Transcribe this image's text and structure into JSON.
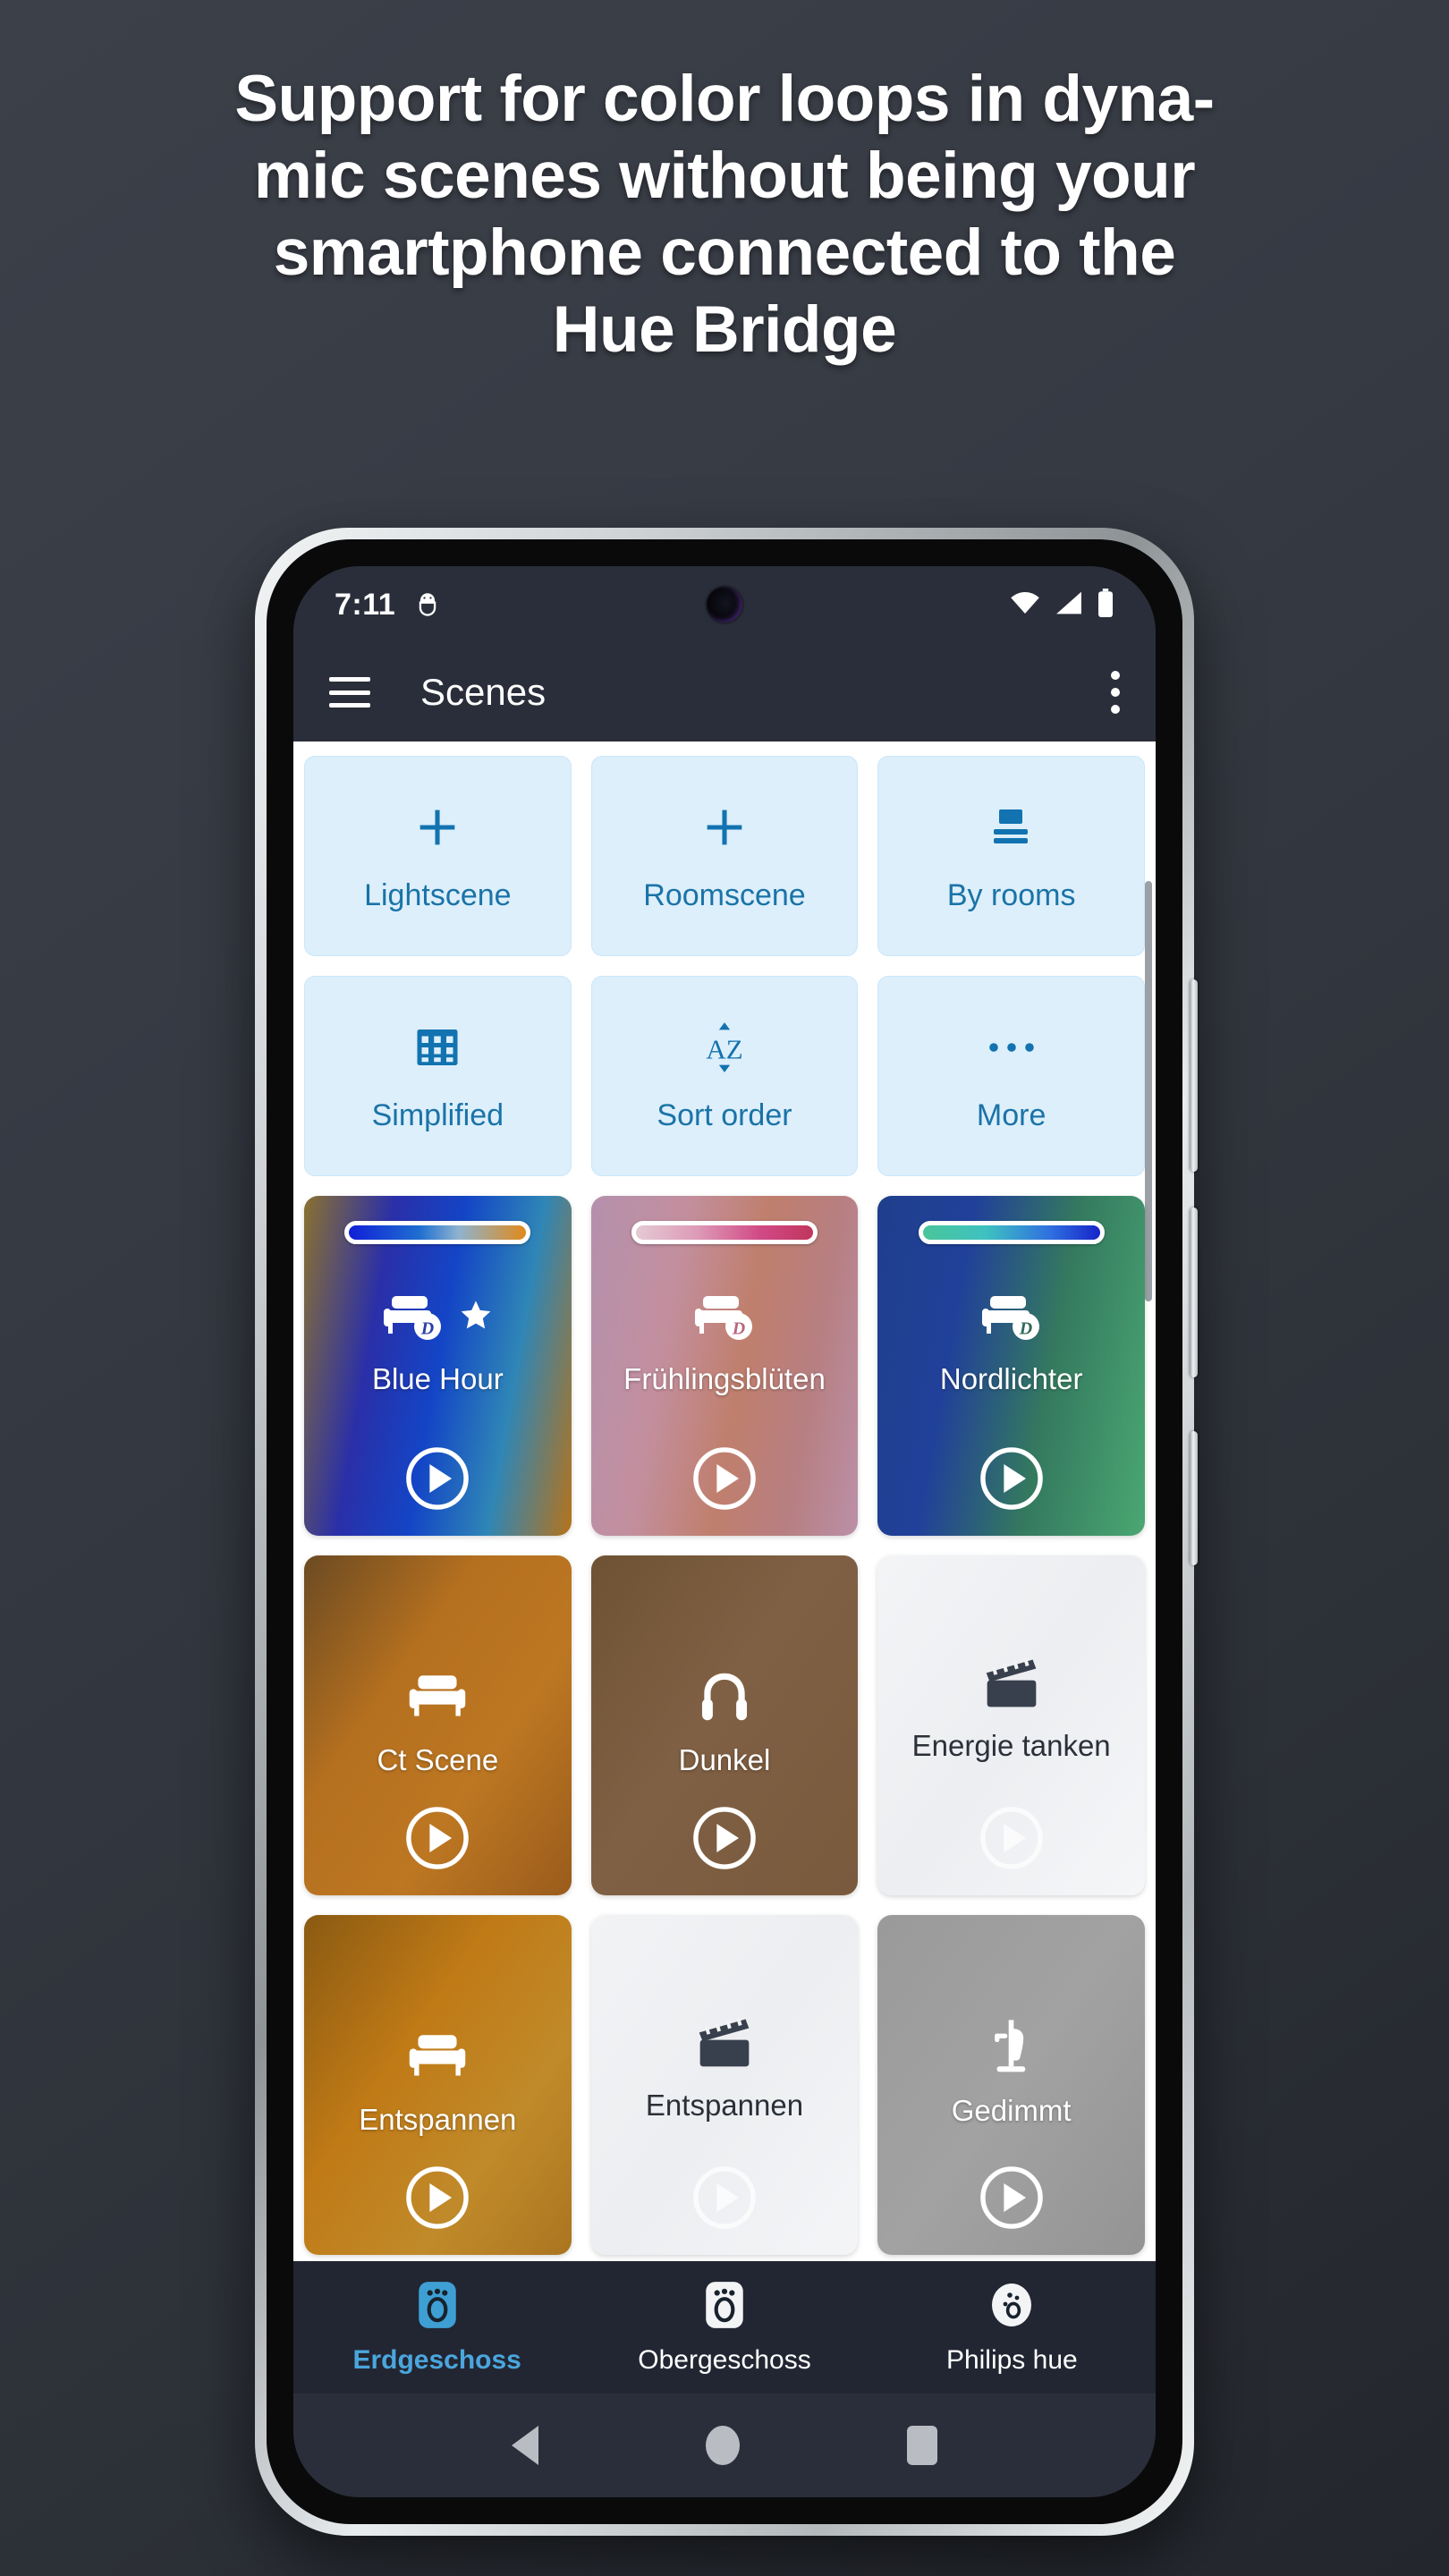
{
  "headline": {
    "lines": [
      "Support for color loops in dyna-",
      "mic scenes without being your",
      "smartphone connected to the",
      "Hue Bridge"
    ],
    "color": "#ffffff"
  },
  "phone": {
    "statusbar": {
      "time": "7:11",
      "icons": [
        "android-debug-icon",
        "wifi-icon",
        "cellular-signal-icon",
        "battery-icon"
      ]
    },
    "appbar": {
      "menu_icon": "hamburger-menu-icon",
      "title": "Scenes",
      "overflow_icon": "overflow-menu-icon"
    },
    "action_tiles": [
      {
        "label": "Lightscene",
        "icon": "plus-icon"
      },
      {
        "label": "Roomscene",
        "icon": "plus-icon"
      },
      {
        "label": "By rooms",
        "icon": "list-by-rooms-icon"
      },
      {
        "label": "Simplified",
        "icon": "grid-simplified-icon"
      },
      {
        "label": "Sort order",
        "icon": "sort-az-icon"
      },
      {
        "label": "More",
        "icon": "more-dots-icon"
      }
    ],
    "tile_colors": {
      "background": "#ddeffb",
      "border": "#cbe6f7",
      "accent": "#1273b0",
      "label": "#1a73a8"
    },
    "scenes": [
      {
        "name": "Blue Hour",
        "icon": "sofa-dynamic-icon",
        "favorite": true,
        "favorite_icon": "star-icon",
        "play_icon": "play-icon",
        "dynamic_badge": "D",
        "text_theme": "light",
        "card_gradient": "linear-gradient(100deg, #8a7130 0%, #2a2fa8 28%, #1345c6 50%, #2f86b6 74%, #b5731b 100%)",
        "bar_gradient": "linear-gradient(90deg, #1020d8 0%, #1f6fd0 40%, #8fb3cf 62%, #e08a1a 100%)"
      },
      {
        "name": "Frühlingsblüten",
        "icon": "sofa-dynamic-icon",
        "favorite": false,
        "play_icon": "play-icon",
        "dynamic_badge": "D",
        "text_theme": "light",
        "card_gradient": "linear-gradient(100deg, #b490ad 0%, #c38f9e 30%, #c07f6d 55%, #b77f82 78%, #bb90a8 100%)",
        "bar_gradient": "linear-gradient(90deg, #e4cad4 0%, #dd9ab6 35%, #d14a86 70%, #c1355e 100%)"
      },
      {
        "name": "Nordlichter",
        "icon": "sofa-dynamic-icon",
        "favorite": false,
        "play_icon": "play-icon",
        "dynamic_badge": "D",
        "text_theme": "light",
        "card_gradient": "linear-gradient(100deg, #1f3f8c 0%, #21409a 30%, #34795f 62%, #4aa772 100%)",
        "bar_gradient": "linear-gradient(90deg, #49c59a 0%, #3fc2c0 35%, #2f6fe0 72%, #1624c8 100%)"
      },
      {
        "name": "Ct Scene",
        "icon": "sofa-icon",
        "favorite": false,
        "play_icon": "play-icon",
        "text_theme": "light",
        "card_gradient": "linear-gradient(125deg, #6b4a22 0%, #b5701f 35%, #bd7722 65%, #9a5c1c 100%)"
      },
      {
        "name": "Dunkel",
        "icon": "headphones-icon",
        "favorite": false,
        "play_icon": "play-icon",
        "text_theme": "light",
        "card_gradient": "linear-gradient(125deg, #6e5233 0%, #806044 45%, #7a5a3d 100%)"
      },
      {
        "name": "Energie tanken",
        "icon": "clapperboard-icon",
        "favorite": false,
        "play_icon": "play-icon",
        "text_theme": "dark",
        "card_gradient": "linear-gradient(125deg, #f3f4f6 0%, #eceef1 50%, #f5f6f8 100%)"
      },
      {
        "name": "Entspannen",
        "icon": "sofa-icon",
        "favorite": false,
        "play_icon": "play-icon",
        "text_theme": "light",
        "card_gradient": "linear-gradient(125deg, #8a5a12 0%, #c07a16 38%, #c08a2a 70%, #ab7520 100%)"
      },
      {
        "name": "Entspannen",
        "icon": "clapperboard-icon",
        "favorite": false,
        "play_icon": "play-icon",
        "text_theme": "dark",
        "card_gradient": "linear-gradient(125deg, #f2f3f5 0%, #eceef1 50%, #f4f5f7 100%)"
      },
      {
        "name": "Gedimmt",
        "icon": "coat-rack-icon",
        "favorite": false,
        "play_icon": "play-icon",
        "text_theme": "light",
        "card_gradient": "linear-gradient(125deg, #9a9a9a 0%, #a2a2a2 50%, #949494 100%)"
      }
    ],
    "bottom_nav": [
      {
        "label": "Erdgeschoss",
        "icon": "floor-tile-icon",
        "active": true
      },
      {
        "label": "Obergeschoss",
        "icon": "floor-tile-icon",
        "active": false
      },
      {
        "label": "Philips hue",
        "icon": "hue-bridge-icon",
        "active": false
      }
    ],
    "nav_active_color": "#4aa6dd",
    "android_nav": [
      {
        "icon": "back-triangle-icon"
      },
      {
        "icon": "home-circle-icon"
      },
      {
        "icon": "recents-square-icon"
      }
    ]
  }
}
